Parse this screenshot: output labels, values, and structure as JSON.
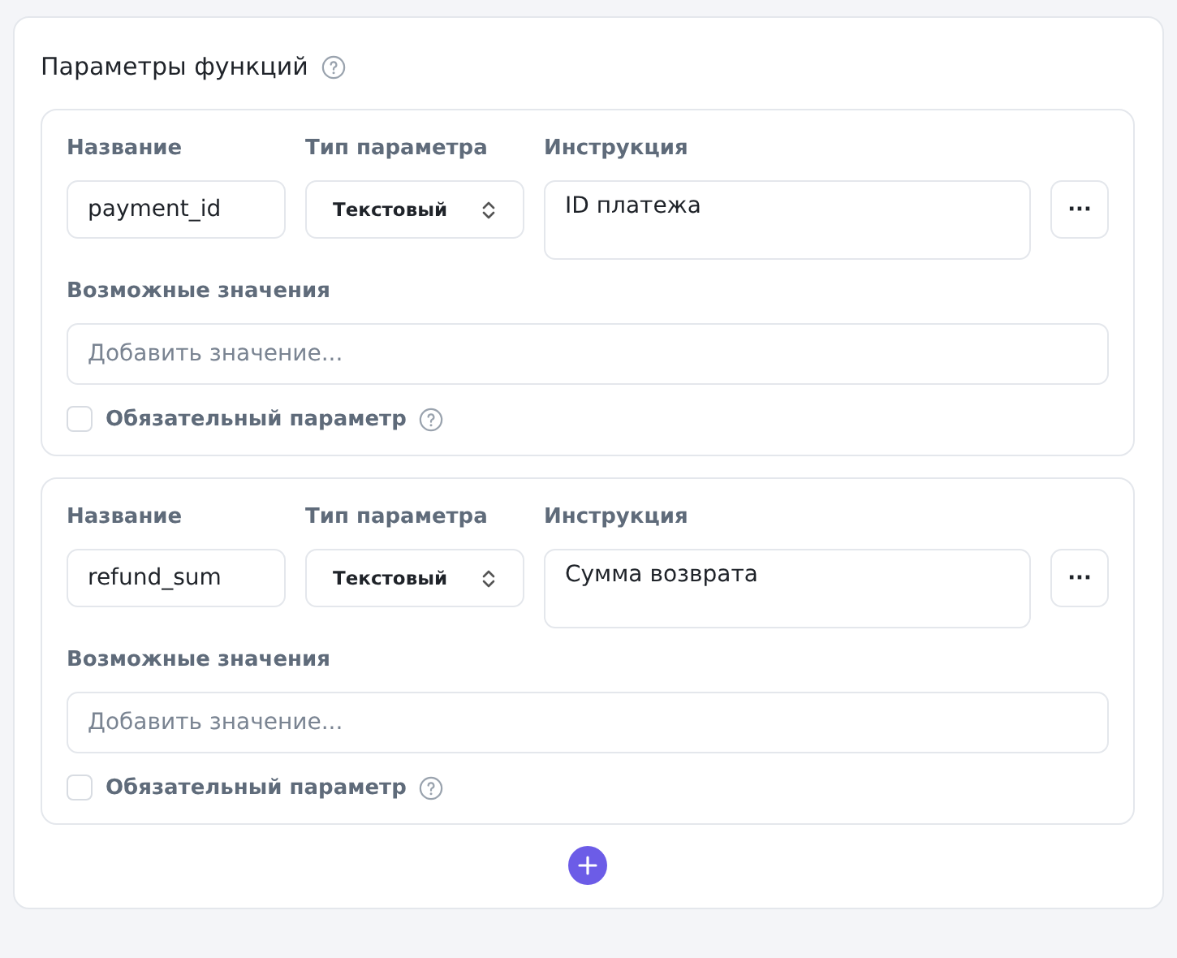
{
  "section": {
    "title": "Параметры функций"
  },
  "parameters": [
    {
      "name_label": "Название",
      "name_value": "payment_id",
      "type_label": "Тип параметра",
      "type_value": "Текстовый",
      "instruction_label": "Инструкция",
      "instruction_value": "ID платежа",
      "more": "···",
      "values_label": "Возможные значения",
      "values_placeholder": "Добавить значение...",
      "required_label": "Обязательный параметр",
      "required": false
    },
    {
      "name_label": "Название",
      "name_value": "refund_sum",
      "type_label": "Тип параметра",
      "type_value": "Текстовый",
      "instruction_label": "Инструкция",
      "instruction_value": "Сумма возврата",
      "more": "···",
      "values_label": "Возможные значения",
      "values_placeholder": "Добавить значение...",
      "required_label": "Обязательный параметр",
      "required": false
    }
  ]
}
